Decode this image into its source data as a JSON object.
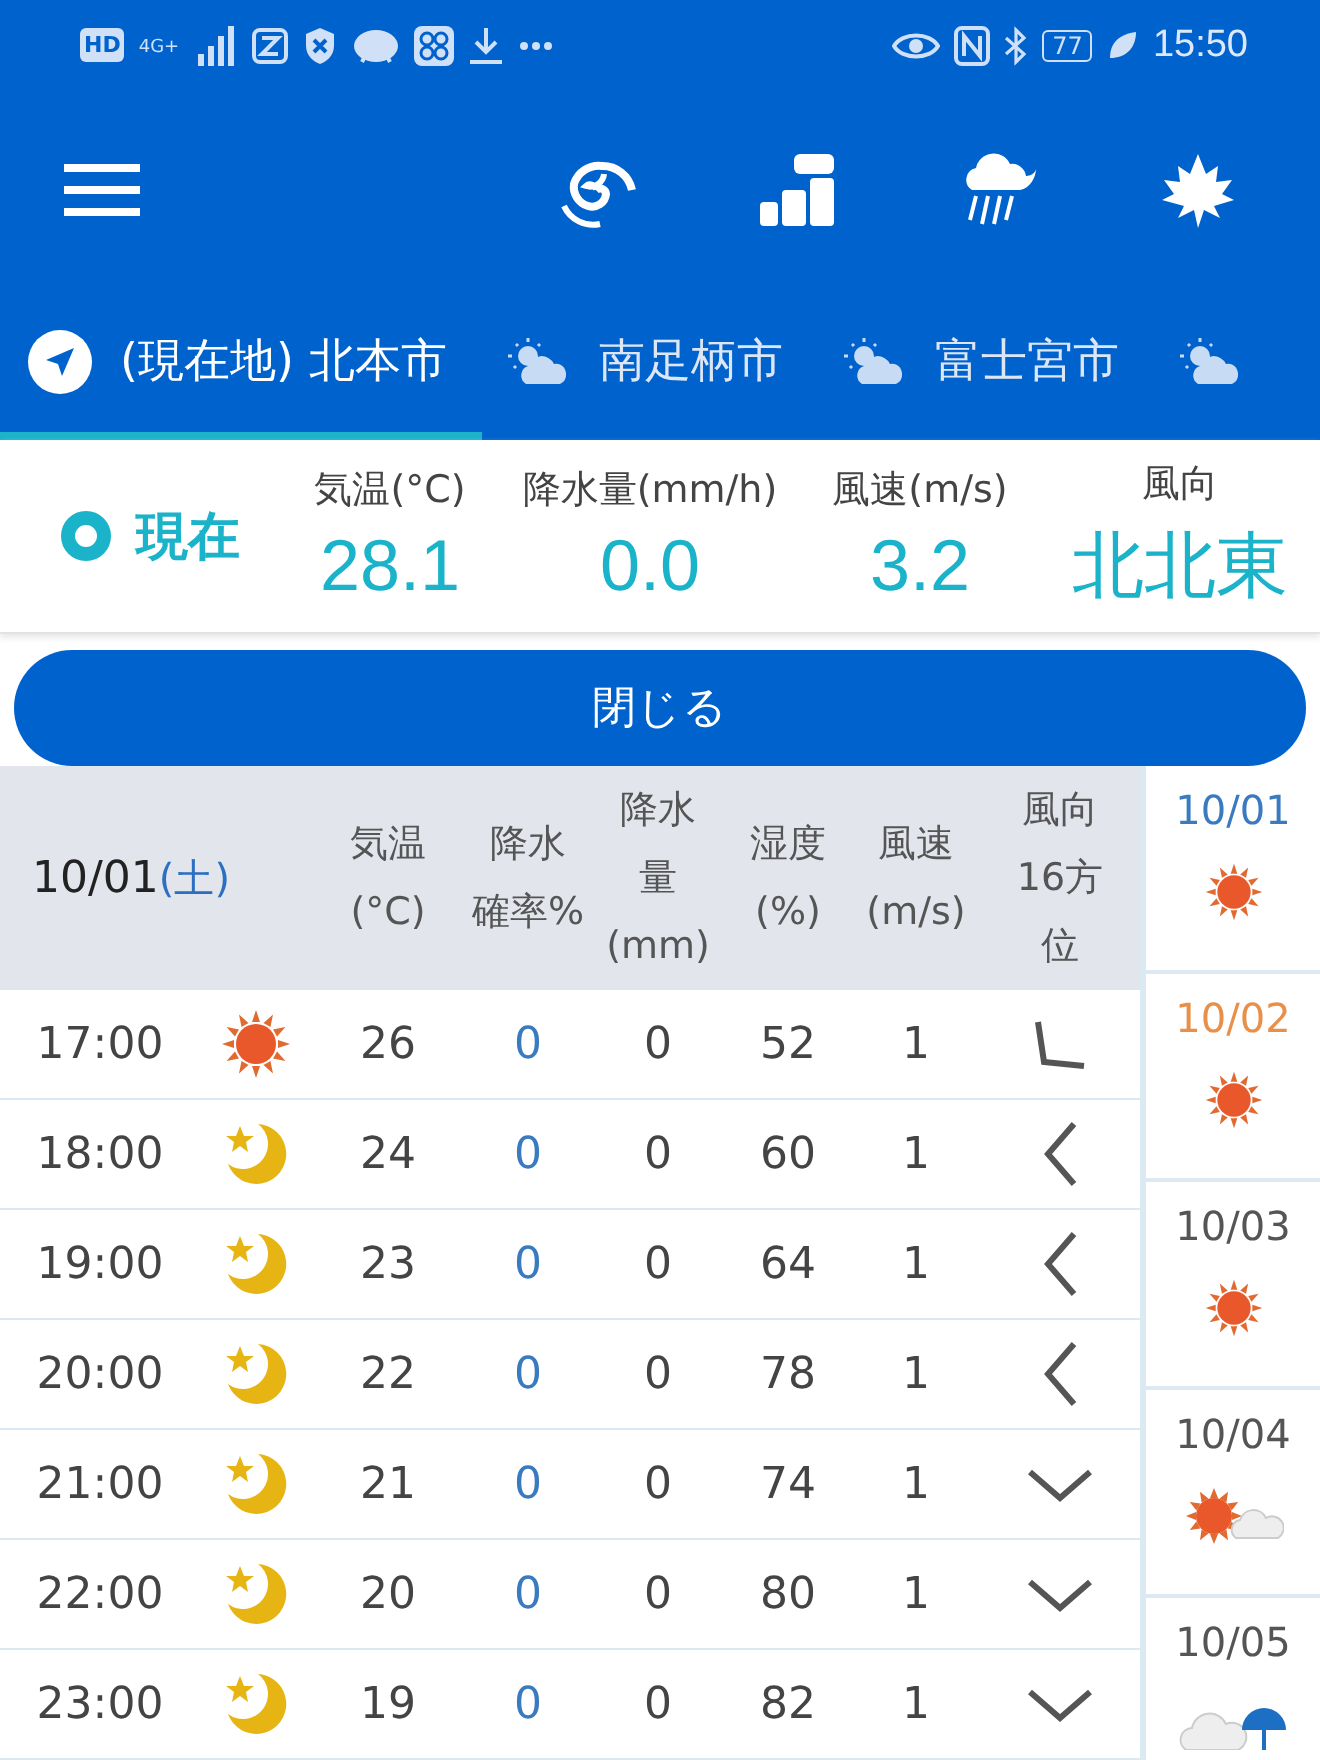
{
  "status_bar": {
    "left_badges": [
      "HD",
      "4G+"
    ],
    "battery": "77",
    "time": "15:50"
  },
  "tabs": [
    {
      "kind": "location",
      "label": "(現在地) 北本市",
      "selected": true
    },
    {
      "kind": "weather",
      "label": "南足柄市",
      "selected": false
    },
    {
      "kind": "weather",
      "label": "富士宮市",
      "selected": false
    },
    {
      "kind": "weather",
      "selected": false
    }
  ],
  "current": {
    "label": "現在",
    "items": [
      {
        "heading": "気温(°C)",
        "value": "28.1"
      },
      {
        "heading": "降水量(mm/h)",
        "value": "0.0"
      },
      {
        "heading": "風速(m/s)",
        "value": "3.2"
      },
      {
        "heading": "風向",
        "value": "北北東"
      }
    ]
  },
  "close_button": "閉じる",
  "table": {
    "date": "10/01",
    "weekday": "(土)",
    "columns": [
      [
        "気温",
        "(°C)"
      ],
      [
        "降水",
        "確率%"
      ],
      [
        "降水",
        "量",
        "(mm)"
      ],
      [
        "湿度",
        "(%)"
      ],
      [
        "風速",
        "(m/s)"
      ],
      [
        "風向",
        "16方",
        "位"
      ]
    ],
    "rows": [
      {
        "time": "17:00",
        "weather": {
          "kind": "sun"
        },
        "temp": "26",
        "prob": "0",
        "amount": "0",
        "humidity": "52",
        "wind": "1",
        "direction": {
          "kind": "corner"
        }
      },
      {
        "time": "18:00",
        "weather": {
          "kind": "moon"
        },
        "temp": "24",
        "prob": "0",
        "amount": "0",
        "humidity": "60",
        "wind": "1",
        "direction": {
          "kind": "left"
        }
      },
      {
        "time": "19:00",
        "weather": {
          "kind": "moon"
        },
        "temp": "23",
        "prob": "0",
        "amount": "0",
        "humidity": "64",
        "wind": "1",
        "direction": {
          "kind": "left"
        }
      },
      {
        "time": "20:00",
        "weather": {
          "kind": "moon"
        },
        "temp": "22",
        "prob": "0",
        "amount": "0",
        "humidity": "78",
        "wind": "1",
        "direction": {
          "kind": "left"
        }
      },
      {
        "time": "21:00",
        "weather": {
          "kind": "moon"
        },
        "temp": "21",
        "prob": "0",
        "amount": "0",
        "humidity": "74",
        "wind": "1",
        "direction": {
          "kind": "down"
        }
      },
      {
        "time": "22:00",
        "weather": {
          "kind": "moon"
        },
        "temp": "20",
        "prob": "0",
        "amount": "0",
        "humidity": "80",
        "wind": "1",
        "direction": {
          "kind": "down"
        }
      },
      {
        "time": "23:00",
        "weather": {
          "kind": "moon"
        },
        "temp": "19",
        "prob": "0",
        "amount": "0",
        "humidity": "82",
        "wind": "1",
        "direction": {
          "kind": "down"
        }
      }
    ]
  },
  "days": [
    {
      "date": "10/01",
      "kind": "sun",
      "color": "#3a7bbf"
    },
    {
      "date": "10/02",
      "kind": "sun",
      "color": "#e8904a"
    },
    {
      "date": "10/03",
      "kind": "sun",
      "color": "#555555"
    },
    {
      "date": "10/04",
      "kind": "partly",
      "color": "#555555"
    },
    {
      "date": "10/05",
      "kind": "rain",
      "color": "#555555"
    }
  ]
}
